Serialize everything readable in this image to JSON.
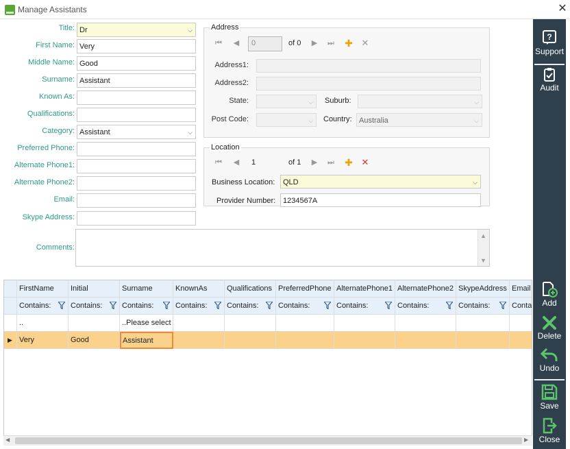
{
  "window": {
    "title": "Manage Assistants"
  },
  "form": {
    "title": {
      "label": "Title:",
      "value": "Dr"
    },
    "first_name": {
      "label": "First Name:",
      "value": "Very"
    },
    "middle_name": {
      "label": "Middle Name:",
      "value": "Good"
    },
    "surname": {
      "label": "Surname:",
      "value": "Assistant"
    },
    "known_as": {
      "label": "Known As:",
      "value": ""
    },
    "qualifications": {
      "label": "Qualifications:",
      "value": ""
    },
    "category": {
      "label": "Category:",
      "value": "Assistant"
    },
    "preferred_phone": {
      "label": "Preferred Phone:",
      "value": ""
    },
    "alternate_phone1": {
      "label": "Alternate Phone1:",
      "value": ""
    },
    "alternate_phone2": {
      "label": "Alternate Phone2:",
      "value": ""
    },
    "email": {
      "label": "Email:",
      "value": ""
    },
    "skype": {
      "label": "Skype Address:",
      "value": ""
    },
    "comments": {
      "label": "Comments:",
      "value": ""
    }
  },
  "address": {
    "title": "Address",
    "nav": {
      "position": "0",
      "of": "of 0"
    },
    "address1_label": "Address1:",
    "address2_label": "Address2:",
    "state_label": "State:",
    "suburb_label": "Suburb:",
    "postcode_label": "Post Code:",
    "country_label": "Country:",
    "country_value": "Australia"
  },
  "location": {
    "title": "Location",
    "nav": {
      "position": "1",
      "of": "of 1"
    },
    "business_location_label": "Business Location:",
    "business_location_value": "QLD",
    "provider_number_label": "Provider Number:",
    "provider_number_value": "1234567A"
  },
  "grid": {
    "columns": [
      "FirstName",
      "Initial",
      "Surname",
      "KnownAs",
      "Qualifications",
      "PreferredPhone",
      "AlternatePhone1",
      "AlternatePhone2",
      "SkypeAddress",
      "Email"
    ],
    "filter_label": "Contains:",
    "new_row": {
      "firstname": "..",
      "surname": "..Please select"
    },
    "rows": [
      {
        "firstname": "Very",
        "initial": "Good",
        "surname": "Assistant"
      }
    ]
  },
  "toolbar": {
    "support": "Support",
    "audit": "Audit",
    "add": "Add",
    "delete": "Delete",
    "undo": "Undo",
    "save": "Save",
    "close": "Close"
  },
  "colors": {
    "accent_green": "#2e9a87",
    "sidebar": "#2f3f4c",
    "selected_row": "#fbd28c",
    "required_field": "#fcfbd9"
  }
}
